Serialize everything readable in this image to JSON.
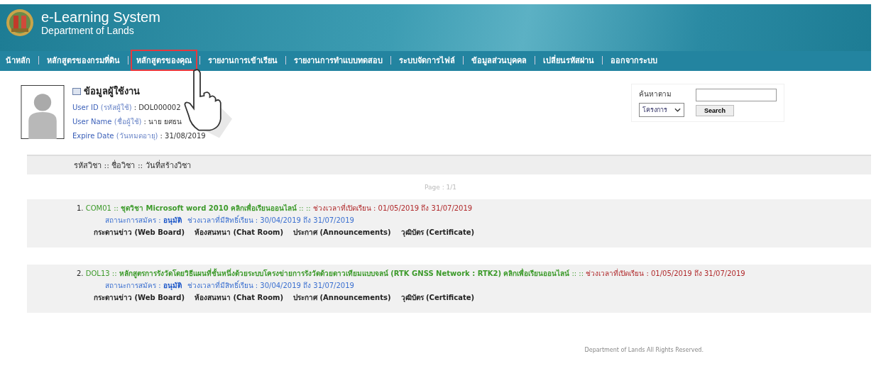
{
  "header": {
    "title": "e-Learning System",
    "subtitle": "Department of Lands"
  },
  "nav": [
    {
      "label": "น้าหลัก",
      "selected": false
    },
    {
      "label": "หลักสูตรของกรมที่ดิน",
      "selected": false
    },
    {
      "label": "หลักสูตรของคุณ",
      "selected": true
    },
    {
      "label": "รายงานการเข้าเรียน",
      "selected": false
    },
    {
      "label": "รายงานการทำแบบทดสอบ",
      "selected": false
    },
    {
      "label": "ระบบจัดการไฟล์",
      "selected": false
    },
    {
      "label": "ข้อมูลส่วนบุคคล",
      "selected": false
    },
    {
      "label": "เปลี่ยนรหัสผ่าน",
      "selected": false
    },
    {
      "label": "ออกจากระบบ",
      "selected": false
    }
  ],
  "user": {
    "heading": "ข้อมูลผู้ใช้งาน",
    "fields": [
      {
        "label": "User ID",
        "label_th": "(รหัสผู้ใช้)",
        "value": ": DOL000002"
      },
      {
        "label": "User Name",
        "label_th": "(ชื่อผู้ใช้)",
        "value": ": นาย ยศธน"
      },
      {
        "label": "Expire Date",
        "label_th": "(วันหมดอายุ)",
        "value": ": 31/08/2019"
      }
    ]
  },
  "search": {
    "label": "ค้นหาตาม",
    "select": "โครงการ",
    "button": "Search"
  },
  "list_header": "รหัสวิชา :: ชื่อวิชา :: วันที่สร้างวิชา",
  "pager": "Page : 1/1",
  "courses": [
    {
      "number": "1.",
      "code": "COM01",
      "sep": "::",
      "name": "ชุดวิชา Microsoft word 2010",
      "link": "คลิกเพื่อเรียนออนไลน์",
      "tail": ":: ::",
      "period": "ช่วงเวลาที่เปิดเรียน : 01/05/2019 ถึง 31/07/2019",
      "status_label": "สถานะการสมัคร :",
      "status": "อนุมัติ",
      "access": "ช่วงเวลาที่มีสิทธิ์เรียน : 30/04/2019 ถึง 31/07/2019",
      "links": [
        "กระดานข่าว (Web Board)",
        "ห้องสนทนา (Chat Room)",
        "ประกาศ (Announcements)",
        "วุฒิบัตร (Certificate)"
      ]
    },
    {
      "number": "2.",
      "code": "DOL13",
      "sep": "::",
      "name": "หลักสูตรการรังวัดโดยวิธีแผนที่ชั้นหนึ่งด้วยระบบโครงข่ายการรังวัดด้วยดาวเทียมแบบจลน์ (RTK GNSS Network : RTK2)",
      "link": "คลิกเพื่อเรียนออนไลน์",
      "tail": ":: ::",
      "period": "ช่วงเวลาที่เปิดเรียน : 01/05/2019 ถึง 31/07/2019",
      "status_label": "สถานะการสมัคร :",
      "status": "อนุมัติ",
      "access": "ช่วงเวลาที่มีสิทธิ์เรียน : 30/04/2019 ถึง 31/07/2019",
      "links": [
        "กระดานข่าว (Web Board)",
        "ห้องสนทนา (Chat Room)",
        "ประกาศ (Announcements)",
        "วุฒิบัตร (Certificate)"
      ]
    }
  ],
  "footer": "Department of Lands All Rights Reserved."
}
